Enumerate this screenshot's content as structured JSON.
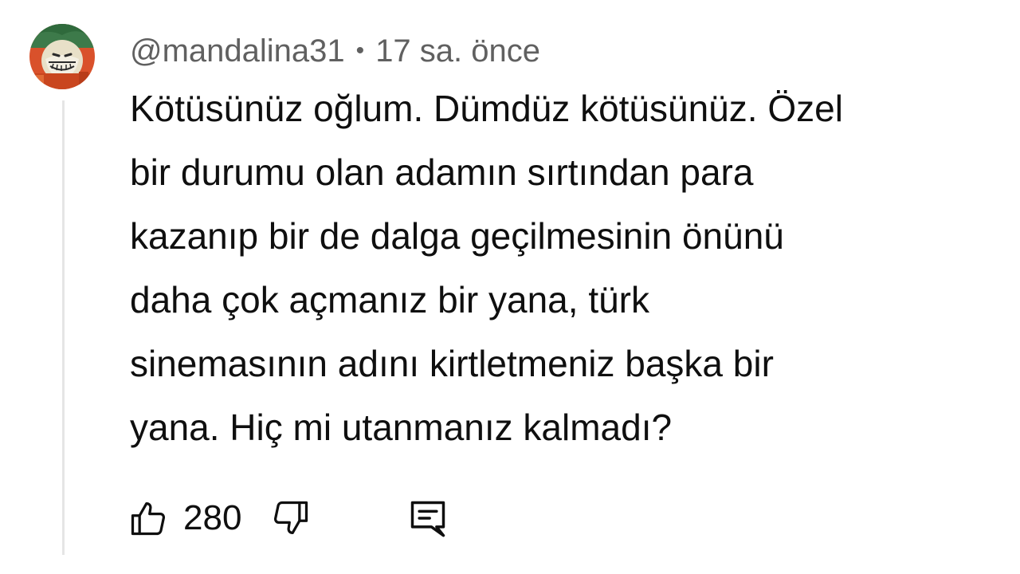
{
  "comment": {
    "author": "@mandalina31",
    "separator": "•",
    "time": "17 sa. önce",
    "text_lines": [
      "Kötüsünüz oğlum. Dümdüz kötüsünüz. Özel",
      "bir durumu olan adamın sırtından para",
      "kazanıp bir de dalga geçilmesinin önünü",
      "daha çok açmanız bir yana, türk",
      "sinemasının adını kirtletmeniz başka bir",
      "yana. Hiç mi utanmanız kalmadı?"
    ],
    "like_count": "280",
    "icons": {
      "like": "thumbs-up-icon",
      "dislike": "thumbs-down-icon",
      "reply": "reply-comment-icon",
      "avatar": "avatar"
    }
  }
}
